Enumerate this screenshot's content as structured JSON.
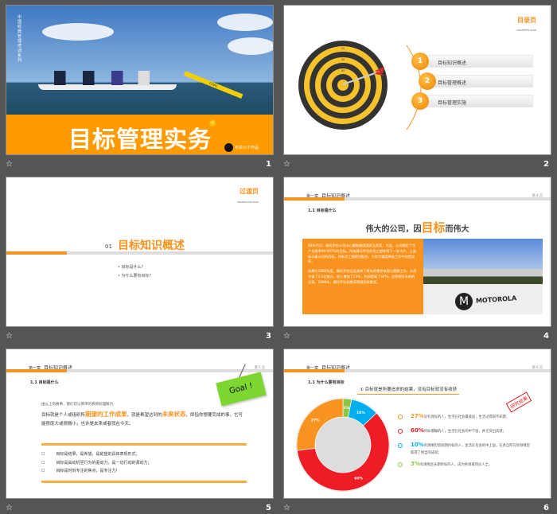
{
  "slides": [
    {
      "number": "1",
      "title": "目标管理实务",
      "vertical_text": "中国经典管理培训系列",
      "badge": "v2",
      "author": "布衣公子作品",
      "flag_text": "GOAL"
    },
    {
      "number": "2",
      "page_title": "目录页",
      "page_subtitle": "CONTENTS PAGE",
      "items": [
        {
          "n": "1",
          "label": "目标知识概述"
        },
        {
          "n": "2",
          "label": "目标管理概述"
        },
        {
          "n": "3",
          "label": "目标管理实施"
        }
      ],
      "target_rings": [
        "10",
        "20",
        "30",
        "40",
        "50",
        "60",
        "80"
      ]
    },
    {
      "number": "3",
      "page_title": "过渡页",
      "page_subtitle": "TRANSITION PAGE",
      "section_no": "01",
      "section_title": "目标知识概述",
      "bullets": [
        "目标是什么？",
        "为什么要有目标？"
      ]
    },
    {
      "number": "4",
      "chapter": "第一章",
      "chapter_title": "目标知识概述",
      "page": "第 4 页",
      "subtitle": "1.1  目标是什么",
      "heading_pre": "伟大的公司，因",
      "heading_hl": "目标",
      "heading_post": "而伟大",
      "para1": "80年代初，摩托罗拉公司决心赢取美国国家品质奖，为此，公司确定了生产合格率99.997%的目标。所有摩托罗拉的员工都收到了一张卡片，上面标示着公司的目标，所有员工都密切配合，力求大幅度降低工作中的错误率。",
      "para2": "结果在1988年度，摩托罗拉因此减掉了原先的零件修理与替换工作，从而节省了2.5亿美元，收入增加了23%，利润提高了44%，达到前所未有的记录。1989年，摩托罗拉如愿获得国家质量奖。",
      "photo_sign": "MOTOROLA"
    },
    {
      "number": "5",
      "chapter": "第一章",
      "chapter_title": "目标知识概述",
      "page": "第 5 页",
      "subtitle": "1.1  目标是什么",
      "note": "Goal !",
      "intro": "由以上的故事，我们可以简单的将目标理解为：",
      "def_a": "目标就是个人或组织所",
      "def_hl1": "期望的工作成果",
      "def_b": "，就是希望达到的",
      "def_hl2": "未来状态",
      "def_c": "，即指你想要完成的事，它可能很庞大或很微小，也许是未来或者就在今天。",
      "bullets": [
        "目标是结果，是希望，是欲望的具体表现形式；",
        "目标是由动机至行为的驱动力，是一切行动的源动力；",
        "目标是时刻专注的焦点，是专注力！"
      ]
    },
    {
      "number": "6",
      "chapter": "第一章",
      "chapter_title": "目标知识概述",
      "page": "第 6 页",
      "subtitle": "1.1  为什么要有目标",
      "heading": "① 目标就是所要追求的结果，没有目标就没有收获",
      "stamp": "研究结果",
      "chart_data": {
        "type": "pie",
        "donut": true,
        "categories": [
          "3%",
          "10%",
          "60%",
          "27%"
        ],
        "values": [
          3,
          10,
          60,
          27
        ],
        "colors": [
          "#8dc63f",
          "#00aeef",
          "#ee1c25",
          "#f7931e"
        ]
      },
      "legend": [
        {
          "pct": "27%",
          "text": "没有目标的人，生活在社会最底层，生活过得很不如意；",
          "color": "#f7931e"
        },
        {
          "pct": "60%",
          "text": "目标模糊的人，生活在社会的中下层，并无突出成就；",
          "color": "#ee1c25"
        },
        {
          "pct": "10%",
          "text": "有清晰但较短期目标的人，生活在社会的中上层，在各自所在的领域里取得了相当的成就；",
          "color": "#00aeef"
        },
        {
          "pct": "3%",
          "text": "有清晰且长期目标的人，成为各领域顶尖人士。",
          "color": "#8dc63f"
        }
      ]
    }
  ],
  "star_icon": "☆"
}
